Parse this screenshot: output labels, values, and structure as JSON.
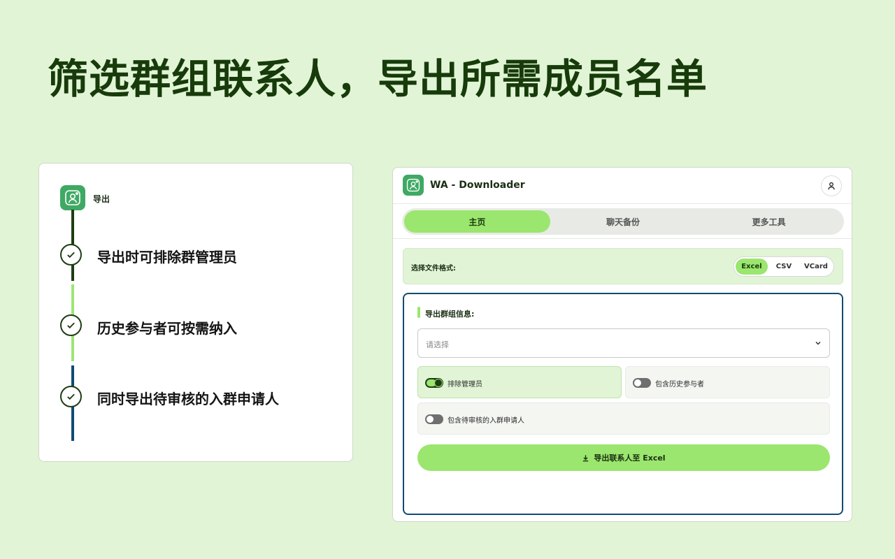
{
  "headline": "筛选群组联系人，导出所需成员名单",
  "left_card": {
    "logo_label": "导出",
    "features": [
      "导出时可排除群管理员",
      "历史参与者可按需纳入",
      "同时导出待审核的入群申请人"
    ]
  },
  "app": {
    "title": "WA - Downloader",
    "tabs": [
      "主页",
      "聊天备份",
      "更多工具"
    ],
    "active_tab": "主页",
    "format": {
      "label": "选择文件格式:",
      "options": [
        "Excel",
        "CSV",
        "VCard"
      ],
      "selected": "Excel"
    },
    "group": {
      "title": "导出群组信息:",
      "select_placeholder": "请选择",
      "options": [
        {
          "label": "排除管理员",
          "checked": true
        },
        {
          "label": "包含历史参与者",
          "checked": false
        },
        {
          "label": "包含待审核的入群申请人",
          "checked": false
        }
      ],
      "export_button": "导出联系人至 Excel"
    }
  },
  "colors": {
    "background": "#e1f5d6",
    "accent_green": "#9be66e",
    "dark_green": "#1e3d14",
    "navy": "#124a73",
    "logo_green": "#3fa964"
  }
}
